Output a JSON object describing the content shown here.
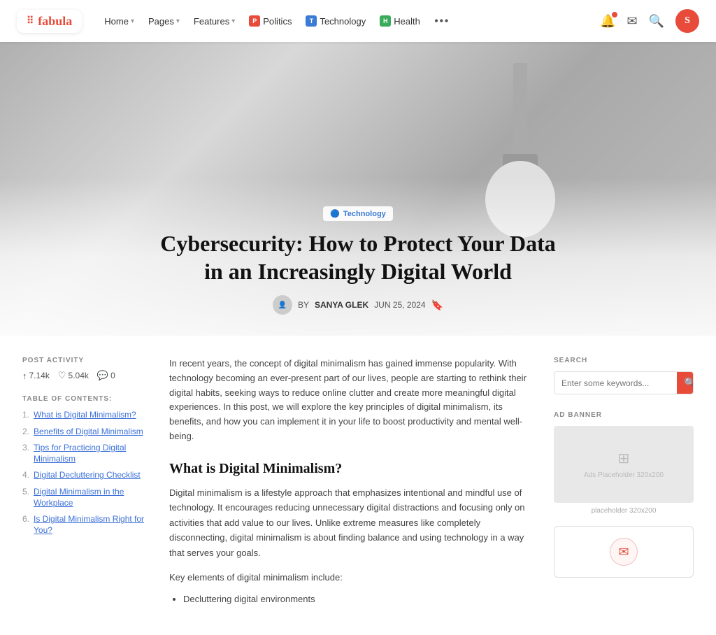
{
  "navbar": {
    "logo_text": "fabula",
    "links": [
      {
        "label": "Home",
        "has_dropdown": true
      },
      {
        "label": "Pages",
        "has_dropdown": true
      },
      {
        "label": "Features",
        "has_dropdown": true
      }
    ],
    "badges": [
      {
        "label": "Politics",
        "icon": "🔴",
        "color": "#e84b3a"
      },
      {
        "label": "Technology",
        "icon": "🔵",
        "color": "#3a7bd5"
      },
      {
        "label": "Health",
        "icon": "🟢",
        "color": "#3aaa5b"
      }
    ],
    "more_icon": "•••"
  },
  "hero": {
    "tag": "Technology",
    "title": "Cybersecurity: How to Protect Your Data in an Increasingly Digital World",
    "author": "SANYA GLEK",
    "date": "JUN 25, 2024",
    "by_label": "BY"
  },
  "post_activity": {
    "label": "POST ACTIVITY",
    "views": "7.14k",
    "likes": "5.04k",
    "comments": "0"
  },
  "toc": {
    "label": "TABLE OF CONTENTS:",
    "items": [
      {
        "num": "1.",
        "text": "What is Digital Minimalism?"
      },
      {
        "num": "2.",
        "text": "Benefits of Digital Minimalism"
      },
      {
        "num": "3.",
        "text": "Tips for Practicing Digital Minimalism"
      },
      {
        "num": "4.",
        "text": "Digital Decluttering Checklist"
      },
      {
        "num": "5.",
        "text": "Digital Minimalism in the Workplace"
      },
      {
        "num": "6.",
        "text": "Is Digital Minimalism Right for You?"
      }
    ]
  },
  "article": {
    "intro": "In recent years, the concept of digital minimalism has gained immense popularity. With technology becoming an ever-present part of our lives, people are starting to rethink their digital habits, seeking ways to reduce online clutter and create more meaningful digital experiences. In this post, we will explore the key principles of digital minimalism, its benefits, and how you can implement it in your life to boost productivity and mental well-being.",
    "h2": "What is Digital Minimalism?",
    "p1": "Digital minimalism is a lifestyle approach that emphasizes intentional and mindful use of technology. It encourages reducing unnecessary digital distractions and focusing only on activities that add value to our lives. Unlike extreme measures like completely disconnecting, digital minimalism is about finding balance and using technology in a way that serves your goals.",
    "p2": "Key elements of digital minimalism include:",
    "bullets": [
      "Decluttering digital environments"
    ]
  },
  "right_sidebar": {
    "search_label": "SEARCH",
    "search_placeholder": "Enter some keywords...",
    "ad_label": "AD BANNER",
    "ad_placeholder_text": "Ads Placeholder 320x200",
    "ad_size": "placeholder 320x200",
    "email_icon": "✉"
  }
}
